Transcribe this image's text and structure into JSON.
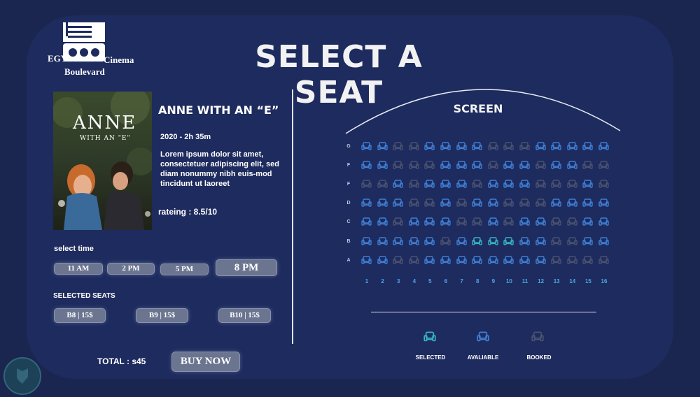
{
  "logo": {
    "top": "EGY",
    "bottom": "Boulevard",
    "right": "Cinema"
  },
  "title": "SELECT A SEAT",
  "movie": {
    "title": "ANNE WITH AN “E”",
    "meta": "2020 - 2h 35m",
    "description": "Lorem ipsum dolor sit amet, consectetuer adipiscing elit, sed diam nonummy nibh euis-mod tincidunt ut laoreet",
    "rating": "rateing : 8.5/10",
    "poster_title_line1": "ANNE",
    "poster_title_line2": "WITH AN \"E\""
  },
  "time": {
    "label": "select time",
    "options": [
      "11 AM",
      "2 PM",
      "5 PM",
      "8 PM"
    ],
    "selected": "8 PM"
  },
  "selected_seats": {
    "label": "SELECTED SEATS",
    "items": [
      "B8 | 15$",
      "B9 | 15$",
      "B10 | 15$"
    ]
  },
  "total": "TOTAL : s45",
  "buy_button": "BUY NOW",
  "screen_label": "SCREEN",
  "rows": [
    "G",
    "F",
    "F",
    "D",
    "C",
    "B",
    "A"
  ],
  "columns": [
    "1",
    "2",
    "3",
    "4",
    "5",
    "6",
    "7",
    "8",
    "9",
    "10",
    "11",
    "12",
    "13",
    "14",
    "15",
    "16"
  ],
  "seat_map": [
    "AABBAAAABBBAAAAA",
    "AABBBAAABAABAABB",
    "BBABAAABAAABBBAB",
    "AAABBABAABBBAAAA",
    "AABAAABBABAABBAA",
    "AAAAABASSSAABBAA",
    "AABBAAAAAAAABBBB"
  ],
  "seat_state_legend": {
    "A": "available",
    "B": "booked",
    "S": "selected"
  },
  "legend": {
    "selected": "SELECTED",
    "available": "AVALIABLE",
    "booked": "BOOKED"
  },
  "colors": {
    "available": "#3f7fd6",
    "booked": "#4a5370",
    "selected": "#36b4c4",
    "background": "#1e2b5e"
  }
}
